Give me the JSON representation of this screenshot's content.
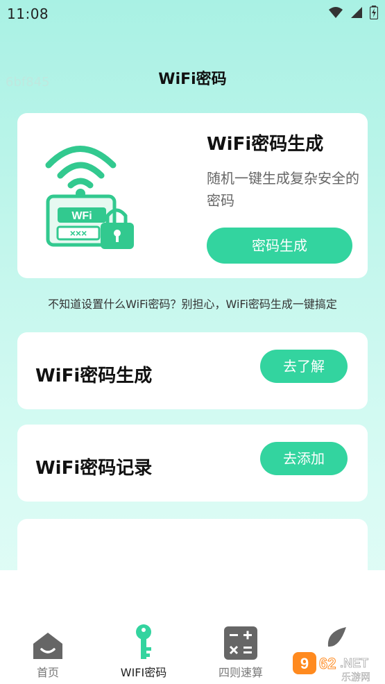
{
  "status": {
    "time": "11:08"
  },
  "header": {
    "title": "WiFi密码",
    "overlay_id": "6bf845"
  },
  "hero": {
    "title": "WiFi密码生成",
    "description": "随机一键生成复杂安全的密码",
    "button_label": "密码生成",
    "illustration": {
      "badge_text": "WFi",
      "mask_text": "×××"
    }
  },
  "tip": "不知道设置什么WiFi密码？别担心，WiFi密码生成一键搞定",
  "features": [
    {
      "title": "WiFi密码生成",
      "button_label": "去了解"
    },
    {
      "title": "WiFi密码记录",
      "button_label": "去添加"
    }
  ],
  "nav": {
    "items": [
      {
        "label": "首页",
        "icon": "home-icon"
      },
      {
        "label": "WIFI密码",
        "icon": "key-icon"
      },
      {
        "label": "四则速算",
        "icon": "calculator-icon"
      },
      {
        "label": "",
        "icon": "leaf-icon"
      }
    ],
    "active_index": 1
  },
  "watermark": {
    "logo_text": "962.NET",
    "logo_subtext": "乐游网"
  },
  "colors": {
    "accent": "#33d49f",
    "illustration_green": "#32c98f",
    "background_top": "#a9f1e4",
    "nav_icon_gray": "#666666"
  }
}
